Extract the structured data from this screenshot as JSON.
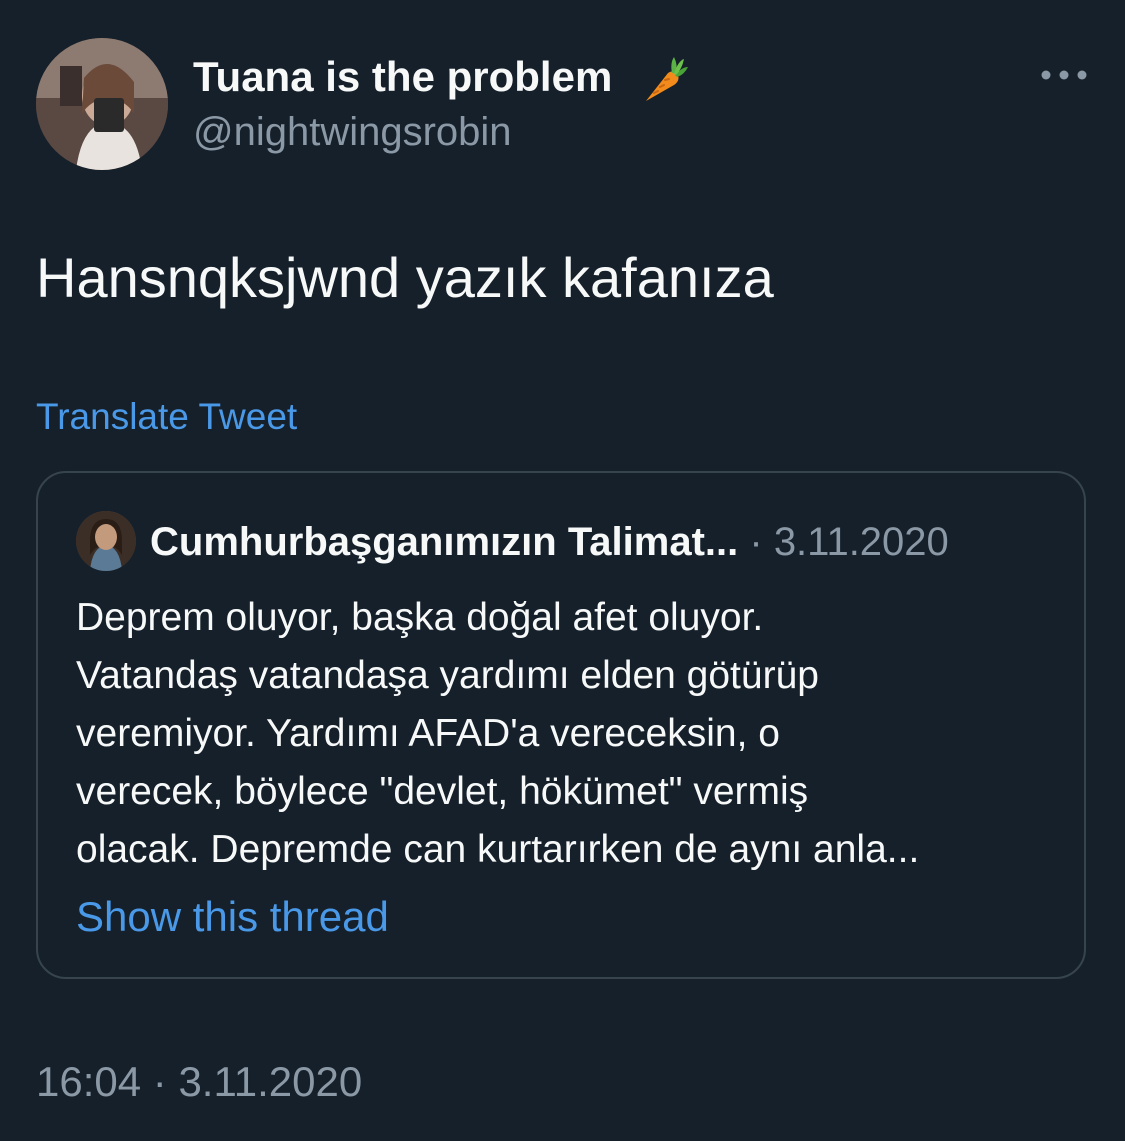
{
  "tweet": {
    "author": {
      "display_name": "Tuana is the problem",
      "handle": "@nightwingsrobin",
      "emoji_icon": "carrot-emoji-icon"
    },
    "more_icon": "more-dots-icon",
    "text": "Hansnqksjwnd yazık kafanıza",
    "translate_label": "Translate Tweet",
    "quoted": {
      "display_name": "Cumhurbaşganımızın Talimat...",
      "separator": "·",
      "date": "3.11.2020",
      "lines": [
        "Deprem oluyor, başka doğal afet oluyor.",
        "Vatandaş vatandaşa yardımı elden götürüp",
        "veremiyor. Yardımı AFAD'a vereceksin, o",
        "verecek, böylece \"devlet, hökümet\" vermiş",
        "olacak. Depremde can kurtarırken de aynı anla..."
      ],
      "show_thread_label": "Show this thread"
    },
    "timestamp": {
      "time": "16:04",
      "separator": "·",
      "date": "3.11.2020"
    }
  },
  "colors": {
    "background": "#15202b",
    "primary_text": "#f7f9f9",
    "secondary_text": "#8b98a5",
    "link": "#4a99e9",
    "border": "#38444d"
  }
}
